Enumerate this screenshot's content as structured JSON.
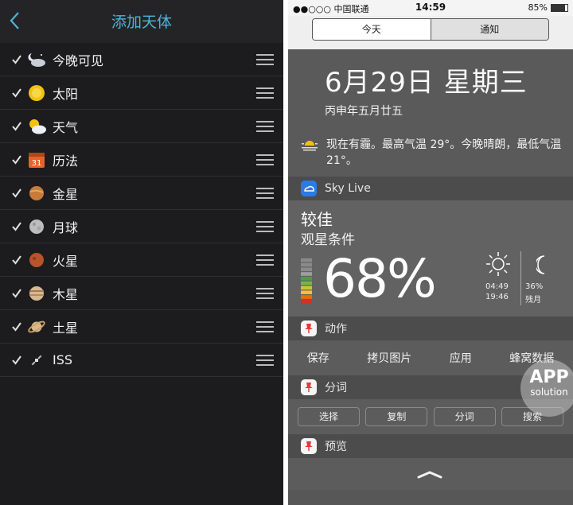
{
  "left": {
    "title": "添加天体",
    "accent": "#4fb3d9",
    "items": [
      {
        "label": "今晚可见",
        "icon": "night-sky-icon",
        "checked": true
      },
      {
        "label": "太阳",
        "icon": "sun-icon",
        "checked": true
      },
      {
        "label": "天气",
        "icon": "weather-icon",
        "checked": true
      },
      {
        "label": "历法",
        "icon": "calendar-icon",
        "checked": true
      },
      {
        "label": "金星",
        "icon": "venus-icon",
        "checked": true
      },
      {
        "label": "月球",
        "icon": "moon-icon",
        "checked": true
      },
      {
        "label": "火星",
        "icon": "mars-icon",
        "checked": true
      },
      {
        "label": "木星",
        "icon": "jupiter-icon",
        "checked": true
      },
      {
        "label": "土星",
        "icon": "saturn-icon",
        "checked": true
      },
      {
        "label": "ISS",
        "icon": "satellite-icon",
        "checked": true
      }
    ],
    "calendar_day": "31"
  },
  "status_bar": {
    "carrier": "●●○○○ 中国联通",
    "time": "14:59",
    "battery": "85%"
  },
  "segments": {
    "today": "今天",
    "notifications": "通知"
  },
  "date": {
    "main": "6月29日 星期三",
    "lunar": "丙申年五月廿五",
    "weather": "现在有霾。最高气温 29°。今晚晴朗，最低气温 21°。"
  },
  "skylive": {
    "app_name": "Sky Live",
    "rating": "较佳",
    "condition_label": "观星条件",
    "percent": "68%",
    "sunrise": "04:49",
    "sunset": "19:46",
    "moon_percent": "36%",
    "moon_phase": "残月",
    "meter_level": 0.68
  },
  "actions": {
    "title": "动作",
    "buttons": [
      "保存",
      "拷贝图片",
      "应用",
      "蜂窝数据"
    ]
  },
  "segmentation": {
    "title": "分词",
    "buttons": [
      "选择",
      "复制",
      "分词",
      "搜索"
    ]
  },
  "preview": {
    "title": "预览"
  },
  "watermark": {
    "line1": "APP",
    "line2": "solution"
  }
}
